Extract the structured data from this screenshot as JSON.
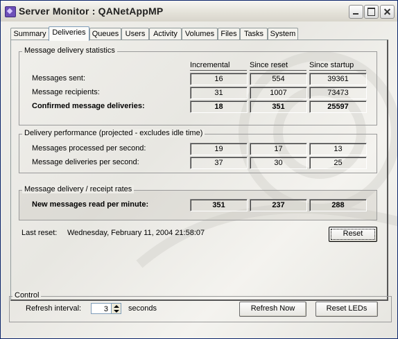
{
  "window": {
    "title": "Server Monitor : QANetAppMP"
  },
  "tabs": [
    "Summary",
    "Deliveries",
    "Queues",
    "Users",
    "Activity",
    "Volumes",
    "Files",
    "Tasks",
    "System"
  ],
  "active_tab": "Deliveries",
  "columns": [
    "Incremental",
    "Since reset",
    "Since startup"
  ],
  "groups": {
    "stats": {
      "title": "Message delivery statistics",
      "rows": [
        {
          "label": "Messages sent:",
          "values": [
            "16",
            "554",
            "39361"
          ]
        },
        {
          "label": "Message recipients:",
          "values": [
            "31",
            "1007",
            "73473"
          ]
        },
        {
          "label": "Confirmed message deliveries:",
          "values": [
            "18",
            "351",
            "25597"
          ]
        }
      ]
    },
    "perf": {
      "title": "Delivery performance (projected - excludes idle time)",
      "rows": [
        {
          "label": "Messages processed per second:",
          "values": [
            "19",
            "17",
            "13"
          ]
        },
        {
          "label": "Message deliveries per second:",
          "values": [
            "37",
            "30",
            "25"
          ]
        }
      ]
    },
    "rates": {
      "title": "Message delivery / receipt rates",
      "rows": [
        {
          "label": "New messages read per minute:",
          "values": [
            "351",
            "237",
            "288"
          ]
        }
      ]
    }
  },
  "last_reset": {
    "label": "Last reset:",
    "value": "Wednesday, February 11, 2004 21:58:07"
  },
  "buttons": {
    "reset": "Reset",
    "refresh_now": "Refresh Now",
    "reset_leds": "Reset LEDs"
  },
  "control": {
    "title": "Control",
    "refresh_label": "Refresh interval:",
    "refresh_value": "3",
    "refresh_unit": "seconds"
  }
}
